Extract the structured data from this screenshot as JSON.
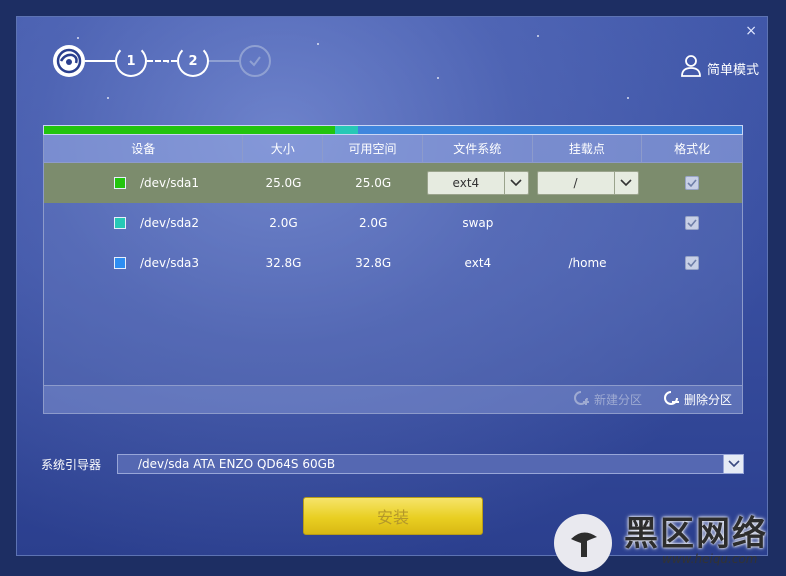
{
  "window": {
    "close_glyph": "×"
  },
  "steps": {
    "step1": "1",
    "step2": "2"
  },
  "header": {
    "mode_label": "简单模式"
  },
  "usage_bar": {
    "segments": [
      {
        "device": "/dev/sda1",
        "fraction": 0.4167,
        "color": "#22c40e"
      },
      {
        "device": "/dev/sda2",
        "fraction": 0.0333,
        "color": "#27c8b6"
      },
      {
        "device": "/dev/sda3",
        "fraction": 0.5467,
        "color": "#3f86dd"
      }
    ]
  },
  "table": {
    "columns": [
      "设备",
      "大小",
      "可用空间",
      "文件系统",
      "挂载点",
      "格式化"
    ],
    "rows": [
      {
        "device": "/dev/sda1",
        "size": "25.0G",
        "free": "25.0G",
        "fs": "ext4",
        "mount": "/",
        "format": true,
        "color": "#22c40e",
        "selected": true
      },
      {
        "device": "/dev/sda2",
        "size": "2.0G",
        "free": "2.0G",
        "fs": "swap",
        "mount": "",
        "format": true,
        "color": "#27c8b6",
        "selected": false
      },
      {
        "device": "/dev/sda3",
        "size": "32.8G",
        "free": "32.8G",
        "fs": "ext4",
        "mount": "/home",
        "format": true,
        "color": "#2e8ef2",
        "selected": false
      }
    ]
  },
  "panel_actions": {
    "new_partition": "新建分区",
    "delete_partition": "删除分区"
  },
  "bootloader": {
    "label": "系统引导器",
    "value": "/dev/sda ATA ENZO QD64S 60GB"
  },
  "install": {
    "label": "安装"
  },
  "watermark": {
    "text": "黑区网络",
    "url": "www.heiqu.com"
  }
}
